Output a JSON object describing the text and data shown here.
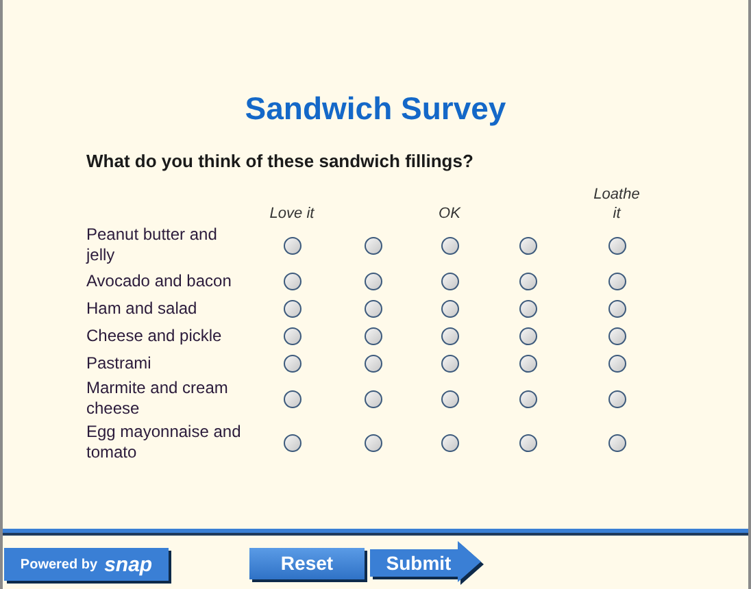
{
  "title": "Sandwich Survey",
  "question": "What do you think of these sandwich fillings?",
  "columns": [
    {
      "label": "Love it"
    },
    {},
    {
      "label": "OK"
    },
    {},
    {
      "label": "Loathe it"
    }
  ],
  "rows": [
    {
      "label": "Peanut butter and jelly",
      "choices": [
        {
          "selected": false
        },
        {
          "selected": false
        },
        {
          "selected": false
        },
        {
          "selected": false
        },
        {
          "selected": false
        }
      ]
    },
    {
      "label": "Avocado and bacon",
      "choices": [
        {
          "selected": false
        },
        {
          "selected": false
        },
        {
          "selected": false
        },
        {
          "selected": false
        },
        {
          "selected": false
        }
      ]
    },
    {
      "label": "Ham and salad",
      "choices": [
        {
          "selected": false
        },
        {
          "selected": false
        },
        {
          "selected": false
        },
        {
          "selected": false
        },
        {
          "selected": false
        }
      ]
    },
    {
      "label": "Cheese and pickle",
      "choices": [
        {
          "selected": false
        },
        {
          "selected": false
        },
        {
          "selected": false
        },
        {
          "selected": false
        },
        {
          "selected": false
        }
      ]
    },
    {
      "label": "Pastrami",
      "choices": [
        {
          "selected": false
        },
        {
          "selected": false
        },
        {
          "selected": false
        },
        {
          "selected": false
        },
        {
          "selected": false
        }
      ]
    },
    {
      "label": "Marmite and cream cheese",
      "choices": [
        {
          "selected": false
        },
        {
          "selected": false
        },
        {
          "selected": false
        },
        {
          "selected": false
        },
        {
          "selected": false
        }
      ]
    },
    {
      "label": "Egg mayonnaise and tomato",
      "choices": [
        {
          "selected": false
        },
        {
          "selected": false
        },
        {
          "selected": false
        },
        {
          "selected": false
        },
        {
          "selected": false
        }
      ]
    }
  ],
  "badge": {
    "prefix": "Powered by",
    "brand": "snap"
  },
  "buttons": [
    {
      "label": "Reset",
      "kind": "plain"
    },
    {
      "label": "Submit",
      "kind": "arrow"
    }
  ]
}
